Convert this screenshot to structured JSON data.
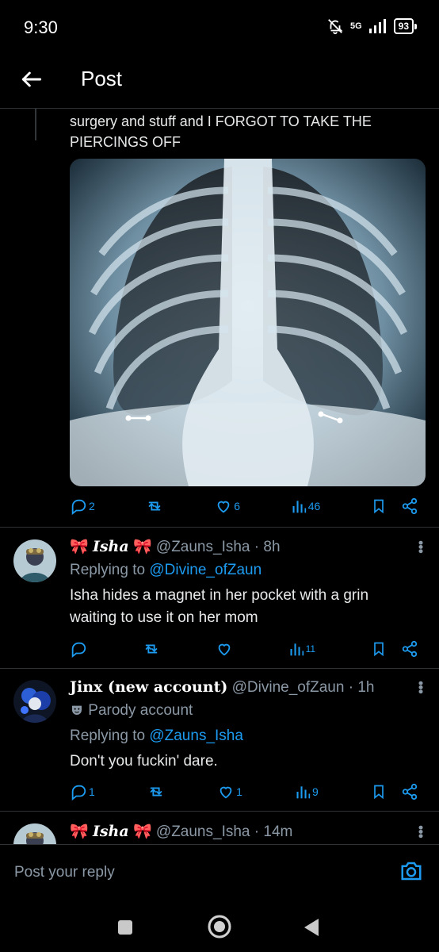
{
  "status_bar": {
    "time": "9:30",
    "network": "5G",
    "battery": "93"
  },
  "header": {
    "title": "Post"
  },
  "main_post": {
    "text_line1": "surgery and stuff and I FORGOT TO TAKE THE",
    "text_line2": "PIERCINGS OFF",
    "replies": "2",
    "reposts": "",
    "likes": "6",
    "views": "46"
  },
  "replies": [
    {
      "name": "Isha",
      "handle": "@Zauns_Isha",
      "time": "· 8h",
      "replying_prefix": "Replying to ",
      "replying_to": "@Divine_ofZaun",
      "text_line1": "Isha hides a magnet in her pocket with a grin",
      "text_line2": "waiting to use it on her mom",
      "replies": "",
      "reposts": "",
      "likes": "",
      "views": "11"
    },
    {
      "name": "Jinx (new account)",
      "handle": "@Divine_ofZaun",
      "time": "· 1h",
      "badge": "Parody account",
      "replying_prefix": "Replying to ",
      "replying_to": "@Zauns_Isha",
      "text_line1": "Don't you fuckin' dare.",
      "replies": "1",
      "reposts": "",
      "likes": "1",
      "views": "9"
    },
    {
      "name": "Isha",
      "handle": "@Zauns_Isha",
      "time": "· 14m"
    }
  ],
  "reply_box": {
    "placeholder": "Post your reply"
  },
  "colors": {
    "accent": "#1d9bf0",
    "muted": "#71767b",
    "background": "#000000"
  }
}
